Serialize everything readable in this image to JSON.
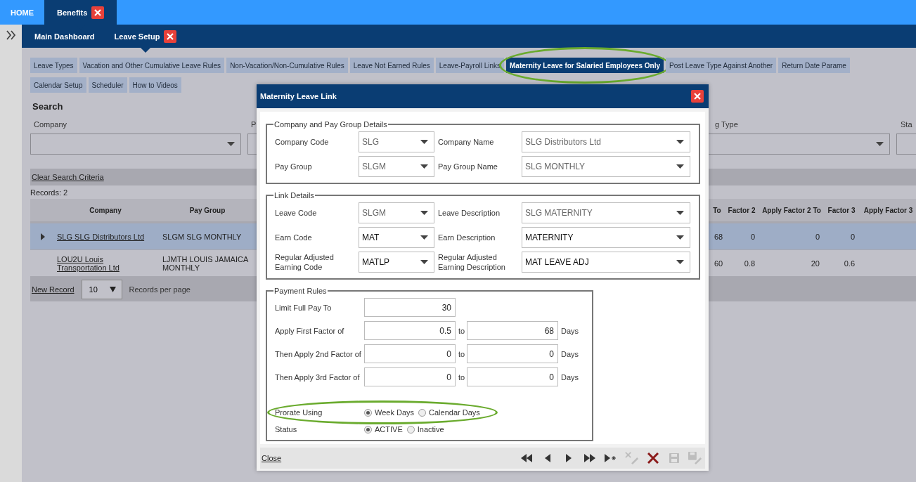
{
  "top_tabs": [
    {
      "label": "HOME",
      "selected": false,
      "closable": false
    },
    {
      "label": "Benefits",
      "selected": true,
      "closable": true
    }
  ],
  "sub_tabs": [
    {
      "label": "Main Dashboard",
      "selected": false,
      "closable": false
    },
    {
      "label": "Leave Setup",
      "selected": true,
      "closable": true
    }
  ],
  "setup_tabs": [
    [
      {
        "label": "Leave Types",
        "selected": false
      },
      {
        "label": "Vacation and Other Cumulative Leave Rules",
        "selected": false
      },
      {
        "label": "Non-Vacation/Non-Cumulative Rules",
        "selected": false
      },
      {
        "label": "Leave Not Earned Rules",
        "selected": false
      },
      {
        "label": "Leave-Payroll Links",
        "selected": false
      },
      {
        "label": "Maternity Leave for Salaried Employees Only",
        "selected": true
      },
      {
        "label": "Post Leave Type Against Another",
        "selected": false
      },
      {
        "label": "Return Date Parame",
        "selected": false
      }
    ],
    [
      {
        "label": "Calendar Setup",
        "selected": false
      },
      {
        "label": "Scheduler",
        "selected": false
      },
      {
        "label": "How to Videos",
        "selected": false
      }
    ]
  ],
  "search": {
    "title": "Search",
    "fields": [
      {
        "label": "Company"
      },
      {
        "label": "P"
      },
      {
        "label": "g Type"
      },
      {
        "label": "Sta"
      }
    ],
    "clear_link": "Clear Search Criteria"
  },
  "records": "Records:  2",
  "table": {
    "columns": [
      "Company",
      "Pay Group",
      "",
      "To",
      "Factor 2",
      "Apply Factor 2 To",
      "Factor 3",
      "Apply Factor 3"
    ],
    "rows": [
      {
        "selected": true,
        "cells": [
          "SLG SLG Distributors Ltd",
          "SLGM SLG MONTHLY",
          "",
          "68",
          "0",
          "0",
          "0",
          ""
        ]
      },
      {
        "selected": false,
        "cells": [
          "LOU2U Louis Transportation Ltd",
          "LJMTH LOUIS JAMAICA MONTHLY",
          "",
          "60",
          "0.8",
          "20",
          "0.6",
          ""
        ]
      }
    ],
    "new_record": "New Record",
    "page_size": "10",
    "per_page": "Records per page"
  },
  "dialog": {
    "title": "Maternity Leave Link",
    "groups": [
      {
        "title": "Company and Pay Group Details",
        "rows": [
          {
            "label": "Company Code",
            "value": "SLG",
            "disabled": true,
            "label2": "Company Name",
            "value2": "SLG Distributors Ltd",
            "disabled2": true
          },
          {
            "label": "Pay Group",
            "value": "SLGM",
            "disabled": true,
            "label2": "Pay Group Name",
            "value2": "SLG MONTHLY",
            "disabled2": true
          }
        ]
      },
      {
        "title": "Link Details",
        "rows": [
          {
            "label": "Leave Code",
            "value": "SLGM",
            "disabled": true,
            "label2": "Leave Description",
            "value2": "SLG MATERNITY",
            "disabled2": true
          },
          {
            "label": "Earn Code",
            "value": "MAT",
            "disabled": false,
            "label2": "Earn Description",
            "value2": "MATERNITY",
            "disabled2": false
          },
          {
            "label": "Regular Adjusted Earning Code",
            "value": "MATLP",
            "disabled": false,
            "label2": "Regular Adjusted Earning Description",
            "value2": "MAT LEAVE ADJ",
            "disabled2": false
          }
        ]
      }
    ],
    "payment": {
      "title": "Payment Rules",
      "rows": [
        {
          "label": "Limit Full Pay To",
          "value": "30"
        },
        {
          "label": "Apply First Factor of",
          "value": "0.5",
          "to": "to",
          "value2": "68",
          "unit": "Days"
        },
        {
          "label": "Then Apply 2nd Factor of",
          "value": "0",
          "to": "to",
          "value2": "0",
          "unit": "Days"
        },
        {
          "label": "Then Apply 3rd Factor of",
          "value": "0",
          "to": "to",
          "value2": "0",
          "unit": "Days"
        }
      ],
      "radios": [
        {
          "label": "Prorate Using",
          "options": [
            {
              "label": "Week Days",
              "selected": true
            },
            {
              "label": "Calendar Days",
              "selected": false
            }
          ]
        },
        {
          "label": "Status",
          "options": [
            {
              "label": "ACTIVE",
              "selected": true
            },
            {
              "label": "Inactive",
              "selected": false
            }
          ]
        }
      ]
    },
    "close_link": "Close",
    "toolbar": [
      {
        "kind": "first",
        "disabled": false
      },
      {
        "kind": "prev",
        "disabled": false
      },
      {
        "kind": "next",
        "disabled": false
      },
      {
        "kind": "last",
        "disabled": false
      },
      {
        "kind": "new",
        "disabled": false
      },
      {
        "kind": "cancel",
        "disabled": true
      },
      {
        "kind": "delete",
        "disabled": false
      },
      {
        "kind": "save",
        "disabled": true
      },
      {
        "kind": "saveedit",
        "disabled": true
      }
    ]
  }
}
